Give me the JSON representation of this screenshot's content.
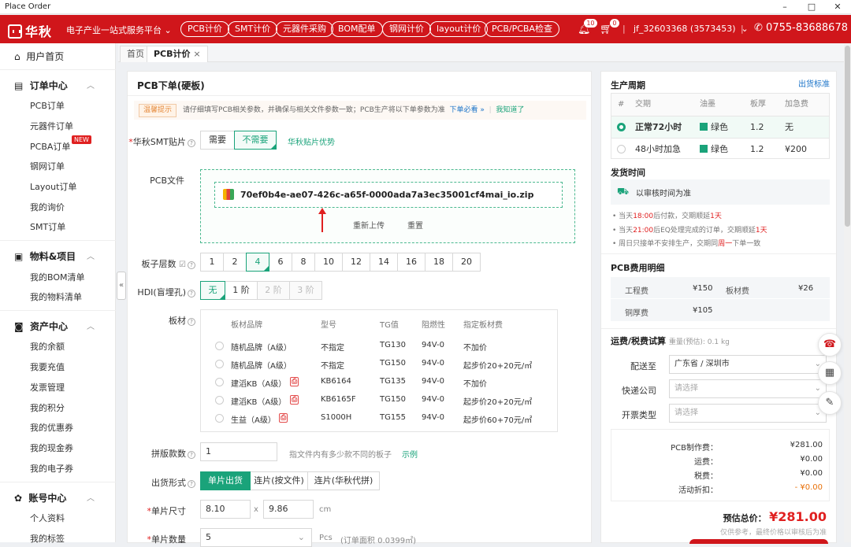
{
  "window": {
    "title": "Place Order",
    "controls": [
      "–",
      "□",
      "✕"
    ]
  },
  "header": {
    "logo_text": "华秋",
    "platform": "电子产业一站式服务平台",
    "nav": [
      "PCB计价",
      "SMT计价",
      "元器件采购",
      "BOM配单",
      "钢网计价",
      "layout计价",
      "PCB/PCBA检查"
    ],
    "bell_count": "10",
    "cart_count": "0",
    "user": "jf_32603368 (3573453)",
    "phone": "0755-83688678"
  },
  "sidebar": {
    "home": "用户首页",
    "groups": [
      {
        "title": "订单中心",
        "items": [
          "PCB订单",
          "元器件订单",
          "PCBA订单",
          "钢网订单",
          "Layout订单",
          "我的询价",
          "SMT订单"
        ]
      },
      {
        "title": "物料&项目",
        "items": [
          "我的BOM清单",
          "我的物料清单"
        ]
      },
      {
        "title": "资产中心",
        "items": [
          "我的余额",
          "我要充值",
          "发票管理",
          "我的积分",
          "我的优惠券",
          "我的现金券",
          "我的电子券"
        ]
      },
      {
        "title": "账号中心",
        "items": [
          "个人资料",
          "我的标签"
        ]
      }
    ],
    "new_badge": "NEW"
  },
  "tabs": [
    {
      "label": "首页"
    },
    {
      "label": "PCB计价",
      "close": "×"
    }
  ],
  "form": {
    "title": "PCB下单(硬板)",
    "notice_tag": "温馨提示",
    "notice_text": "请仔细填写PCB相关参数，并确保与相关文件参数一致；PCB生产将以下单参数为准",
    "notice_link": "下单必看 »",
    "notice_ack": "我知道了",
    "smt": {
      "label": "华秋SMT贴片",
      "options": [
        "需要",
        "不需要"
      ],
      "selected": "不需要",
      "link": "华秋贴片优势"
    },
    "pcb_file": {
      "label": "PCB文件",
      "filename": "70ef0b4e-ae07-426c-a65f-0000ada7a3ec35001cf4mai_io.zip",
      "reupload": "重新上传",
      "reset": "重置"
    },
    "layers": {
      "label": "板子层数",
      "options": [
        "1",
        "2",
        "4",
        "6",
        "8",
        "10",
        "12",
        "14",
        "16",
        "18",
        "20"
      ],
      "selected": "4"
    },
    "hdi": {
      "label": "HDI(盲埋孔)",
      "options": [
        "无",
        "1 阶",
        "2 阶",
        "3 阶"
      ],
      "selected": "无"
    },
    "material": {
      "label": "板材",
      "headers": [
        "板材品牌",
        "型号",
        "TG值",
        "阻燃性",
        "指定板材费"
      ],
      "rows": [
        {
          "brand": "随机品牌（A级）",
          "model": "不指定",
          "tg": "TG130",
          "fr": "94V-0",
          "fee": "不加价",
          "pdf": false
        },
        {
          "brand": "随机品牌（A级）",
          "model": "不指定",
          "tg": "TG150",
          "fr": "94V-0",
          "fee": "起步价20+20元/㎡",
          "pdf": false
        },
        {
          "brand": "建滔KB（A级）",
          "model": "KB6164",
          "tg": "TG135",
          "fr": "94V-0",
          "fee": "不加价",
          "pdf": true
        },
        {
          "brand": "建滔KB（A级）",
          "model": "KB6165F",
          "tg": "TG150",
          "fr": "94V-0",
          "fee": "起步价20+20元/㎡",
          "pdf": true
        },
        {
          "brand": "生益（A级）",
          "model": "S1000H",
          "tg": "TG155",
          "fr": "94V-0",
          "fee": "起步价60+70元/㎡",
          "pdf": true
        }
      ]
    },
    "panel_count": {
      "label": "拼版款数",
      "value": "1",
      "hint": "指文件内有多少款不同的板子",
      "link": "示例"
    },
    "ship_form": {
      "label": "出货形式",
      "options": [
        "单片出货",
        "连片(按文件)",
        "连片(华秋代拼)"
      ],
      "selected": "单片出货"
    },
    "size": {
      "label": "单片尺寸",
      "w": "8.10",
      "x": "x",
      "h": "9.86",
      "unit": "cm"
    },
    "qty": {
      "label": "单片数量",
      "value": "5",
      "unit": "Pcs",
      "area": "(订单面积 0.0399㎡)"
    }
  },
  "right": {
    "cycle": {
      "title": "生产周期",
      "link": "出货标准",
      "headers": [
        "#",
        "交期",
        "油墨",
        "板厚",
        "加急费"
      ],
      "rows": [
        {
          "period": "正常72小时",
          "ink": "绿色",
          "thickness": "1.2",
          "fee": "无",
          "selected": true
        },
        {
          "period": "48小时加急",
          "ink": "绿色",
          "thickness": "1.2",
          "fee": "¥200",
          "selected": false
        }
      ],
      "colors": {
        "ink_green": "#1aa37a"
      }
    },
    "ship_time": {
      "title": "发货时间",
      "info": "以审核时间为准",
      "notes": [
        {
          "a": "当天",
          "b": "18:00",
          "c": "后付款，交期顺延",
          "d": "1天"
        },
        {
          "a": "当天",
          "b": "21:00",
          "c": "后EQ处理完成的订单，交期顺延",
          "d": "1天"
        },
        {
          "a": "周日只接单不安排生产，交期同",
          "b": "周一",
          "c": "下单一致",
          "d": ""
        }
      ]
    },
    "fee_detail": {
      "title": "PCB费用明细",
      "items": [
        {
          "name": "工程费",
          "value": "¥150"
        },
        {
          "name": "板材费",
          "value": "¥26"
        },
        {
          "name": "铜厚费",
          "value": "¥105"
        }
      ]
    },
    "shipping": {
      "title": "运费/税费试算",
      "weight": "重量(预估): 0.1 kg",
      "fields": [
        {
          "label": "配送至",
          "value": "广东省 / 深圳市",
          "placeholder": false
        },
        {
          "label": "快递公司",
          "value": "请选择",
          "placeholder": true
        },
        {
          "label": "开票类型",
          "value": "请选择",
          "placeholder": true
        }
      ]
    },
    "summary": {
      "rows": [
        {
          "label": "PCB制作费：",
          "value": "¥281.00"
        },
        {
          "label": "运费：",
          "value": "¥0.00"
        },
        {
          "label": "税费：",
          "value": "¥0.00"
        },
        {
          "label": "活动折扣：",
          "value": "- ¥0.00"
        }
      ],
      "total_label": "预估总价：",
      "total_value": "¥281.00",
      "disclaimer": "仅供参考，最终价格以审核后为准"
    }
  },
  "colors": {
    "brand_red": "#d0161b",
    "accent_green": "#1aa37a"
  }
}
